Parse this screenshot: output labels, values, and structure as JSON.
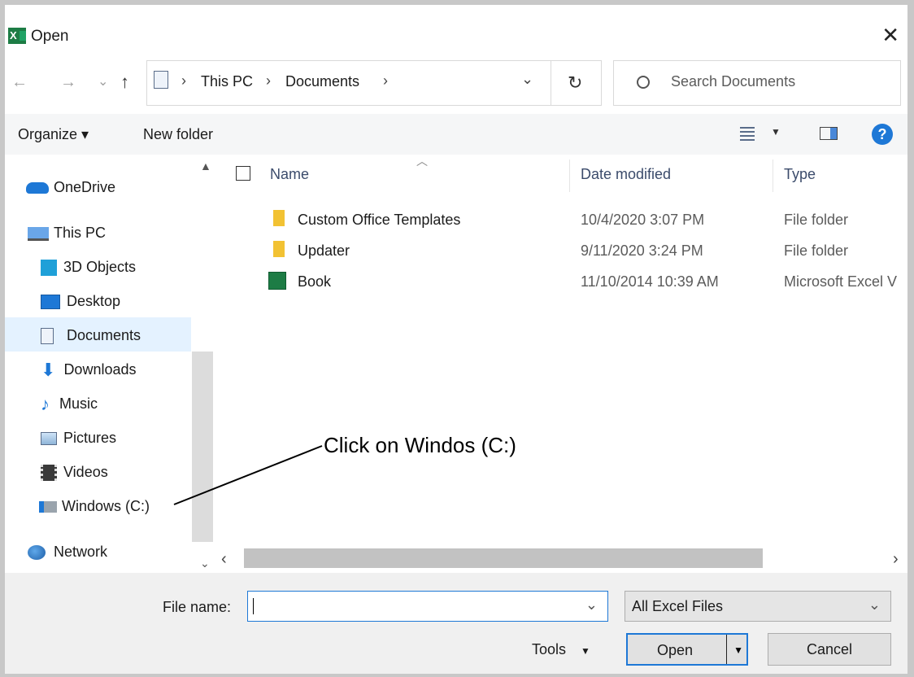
{
  "window": {
    "title": "Open",
    "app_icon": "excel-icon",
    "close_glyph": "✕"
  },
  "nav": {
    "back_glyph": "←",
    "forward_glyph": "→",
    "recent_glyph": "⌄",
    "up_glyph": "↑",
    "breadcrumb": [
      "This PC",
      "Documents"
    ],
    "sep": "›",
    "refresh_glyph": "↻",
    "search_placeholder": "Search Documents",
    "dropdown_glyph": "⌄"
  },
  "toolbar": {
    "organize": "Organize ▾",
    "new_folder": "New folder",
    "help": "?"
  },
  "sidebar": {
    "onedrive": "OneDrive",
    "thispc": "This PC",
    "items": [
      "3D Objects",
      "Desktop",
      "Documents",
      "Downloads",
      "Music",
      "Pictures",
      "Videos",
      "Windows (C:)"
    ],
    "network": "Network",
    "selected": "Documents"
  },
  "table": {
    "columns": [
      "Name",
      "Date modified",
      "Type"
    ],
    "rows": [
      {
        "name": "Custom Office Templates",
        "date": "10/4/2020 3:07 PM",
        "type": "File folder",
        "icon": "folder-icon"
      },
      {
        "name": "Updater",
        "date": "9/11/2020 3:24 PM",
        "type": "File folder",
        "icon": "folder-icon"
      },
      {
        "name": "Book",
        "date": "11/10/2014 10:39 AM",
        "type": "Microsoft Excel V",
        "icon": "excel-file-icon"
      }
    ]
  },
  "bottom": {
    "file_name_label": "File name:",
    "file_name_value": "",
    "file_type": "All Excel Files",
    "tools": "Tools",
    "open": "Open",
    "cancel": "Cancel"
  },
  "annotation": {
    "text": "Click on Windos (C:)"
  },
  "colors": {
    "accent": "#1e78d6",
    "folder": "#f2c233",
    "excel": "#1d7c45"
  }
}
